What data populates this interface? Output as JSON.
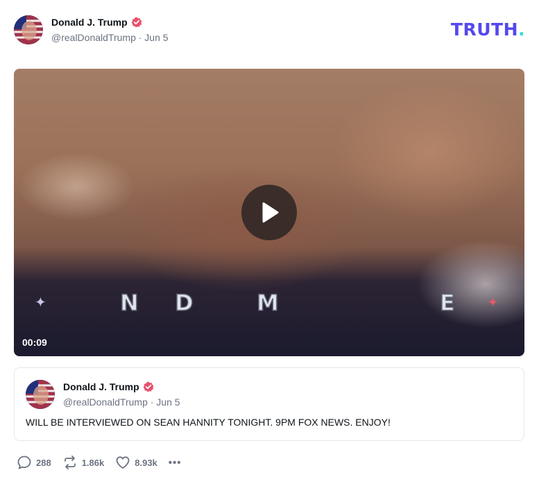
{
  "header": {
    "name": "Donald J. Trump",
    "handle_date": "@realDonaldTrump · Jun 5",
    "logo": "TRUTH",
    "logo_dot": "."
  },
  "video": {
    "duration": "00:09",
    "overlay_letters": [
      "N",
      "D",
      "M",
      "E"
    ]
  },
  "quote": {
    "name": "Donald J. Trump",
    "handle_date": "@realDonaldTrump · Jun 5",
    "text": "WILL BE INTERVIEWED ON SEAN HANNITY TONIGHT. 9PM FOX NEWS. ENJOY!"
  },
  "actions": {
    "replies": "288",
    "retruths": "1.86k",
    "likes": "8.93k",
    "more": "•••"
  },
  "colors": {
    "brand": "#5448ee",
    "brand_accent": "#31e2c8",
    "verified": "#e8506b",
    "muted": "#6b7280"
  },
  "icons": {
    "verified": "verified-badge-icon",
    "play": "play-icon",
    "reply": "reply-icon",
    "retruth": "retruth-icon",
    "like": "heart-icon",
    "more": "more-icon"
  }
}
